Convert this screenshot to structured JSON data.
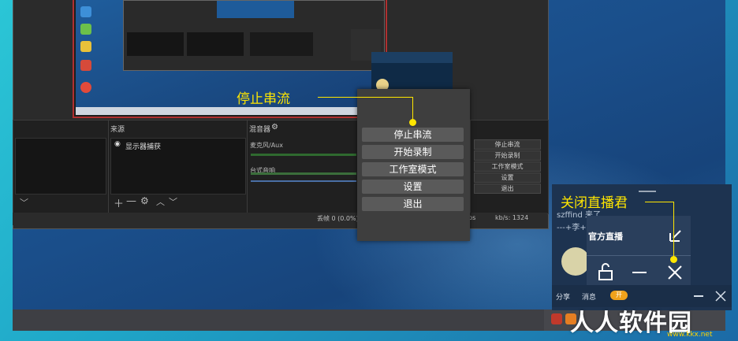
{
  "preview_app": {
    "sources_header": "来源",
    "mixer_header": "混音器",
    "source_item": "显示器捕获",
    "mixer_tracks": [
      "麦克风/Aux",
      "台式音响"
    ],
    "controls": [
      "停止串流",
      "开始录制",
      "工作室模式",
      "设置",
      "退出"
    ],
    "status_left": "丢帧 0 (0.0%)",
    "status_fps": "ps",
    "status_kbps": "kb/s: 1324"
  },
  "context_menu": {
    "items": [
      "停止串流",
      "开始录制",
      "工作室模式",
      "设置",
      "退出"
    ]
  },
  "callouts": {
    "stop_stream": "停止串流",
    "close_app": "关闭直播君"
  },
  "widget": {
    "chat_line1": "szffind 来了",
    "chat_line2": "---+李+",
    "title": "官方直播",
    "bottom_share": "分享",
    "bottom_msg": "消息",
    "bottom_toggle": "开"
  },
  "watermark": {
    "main": "人人软件园",
    "url": "www.kkx.net"
  },
  "colors": {
    "callout": "#ffe600",
    "menu_bg": "#3e3e3e",
    "menu_item": "#5a5a5a"
  }
}
